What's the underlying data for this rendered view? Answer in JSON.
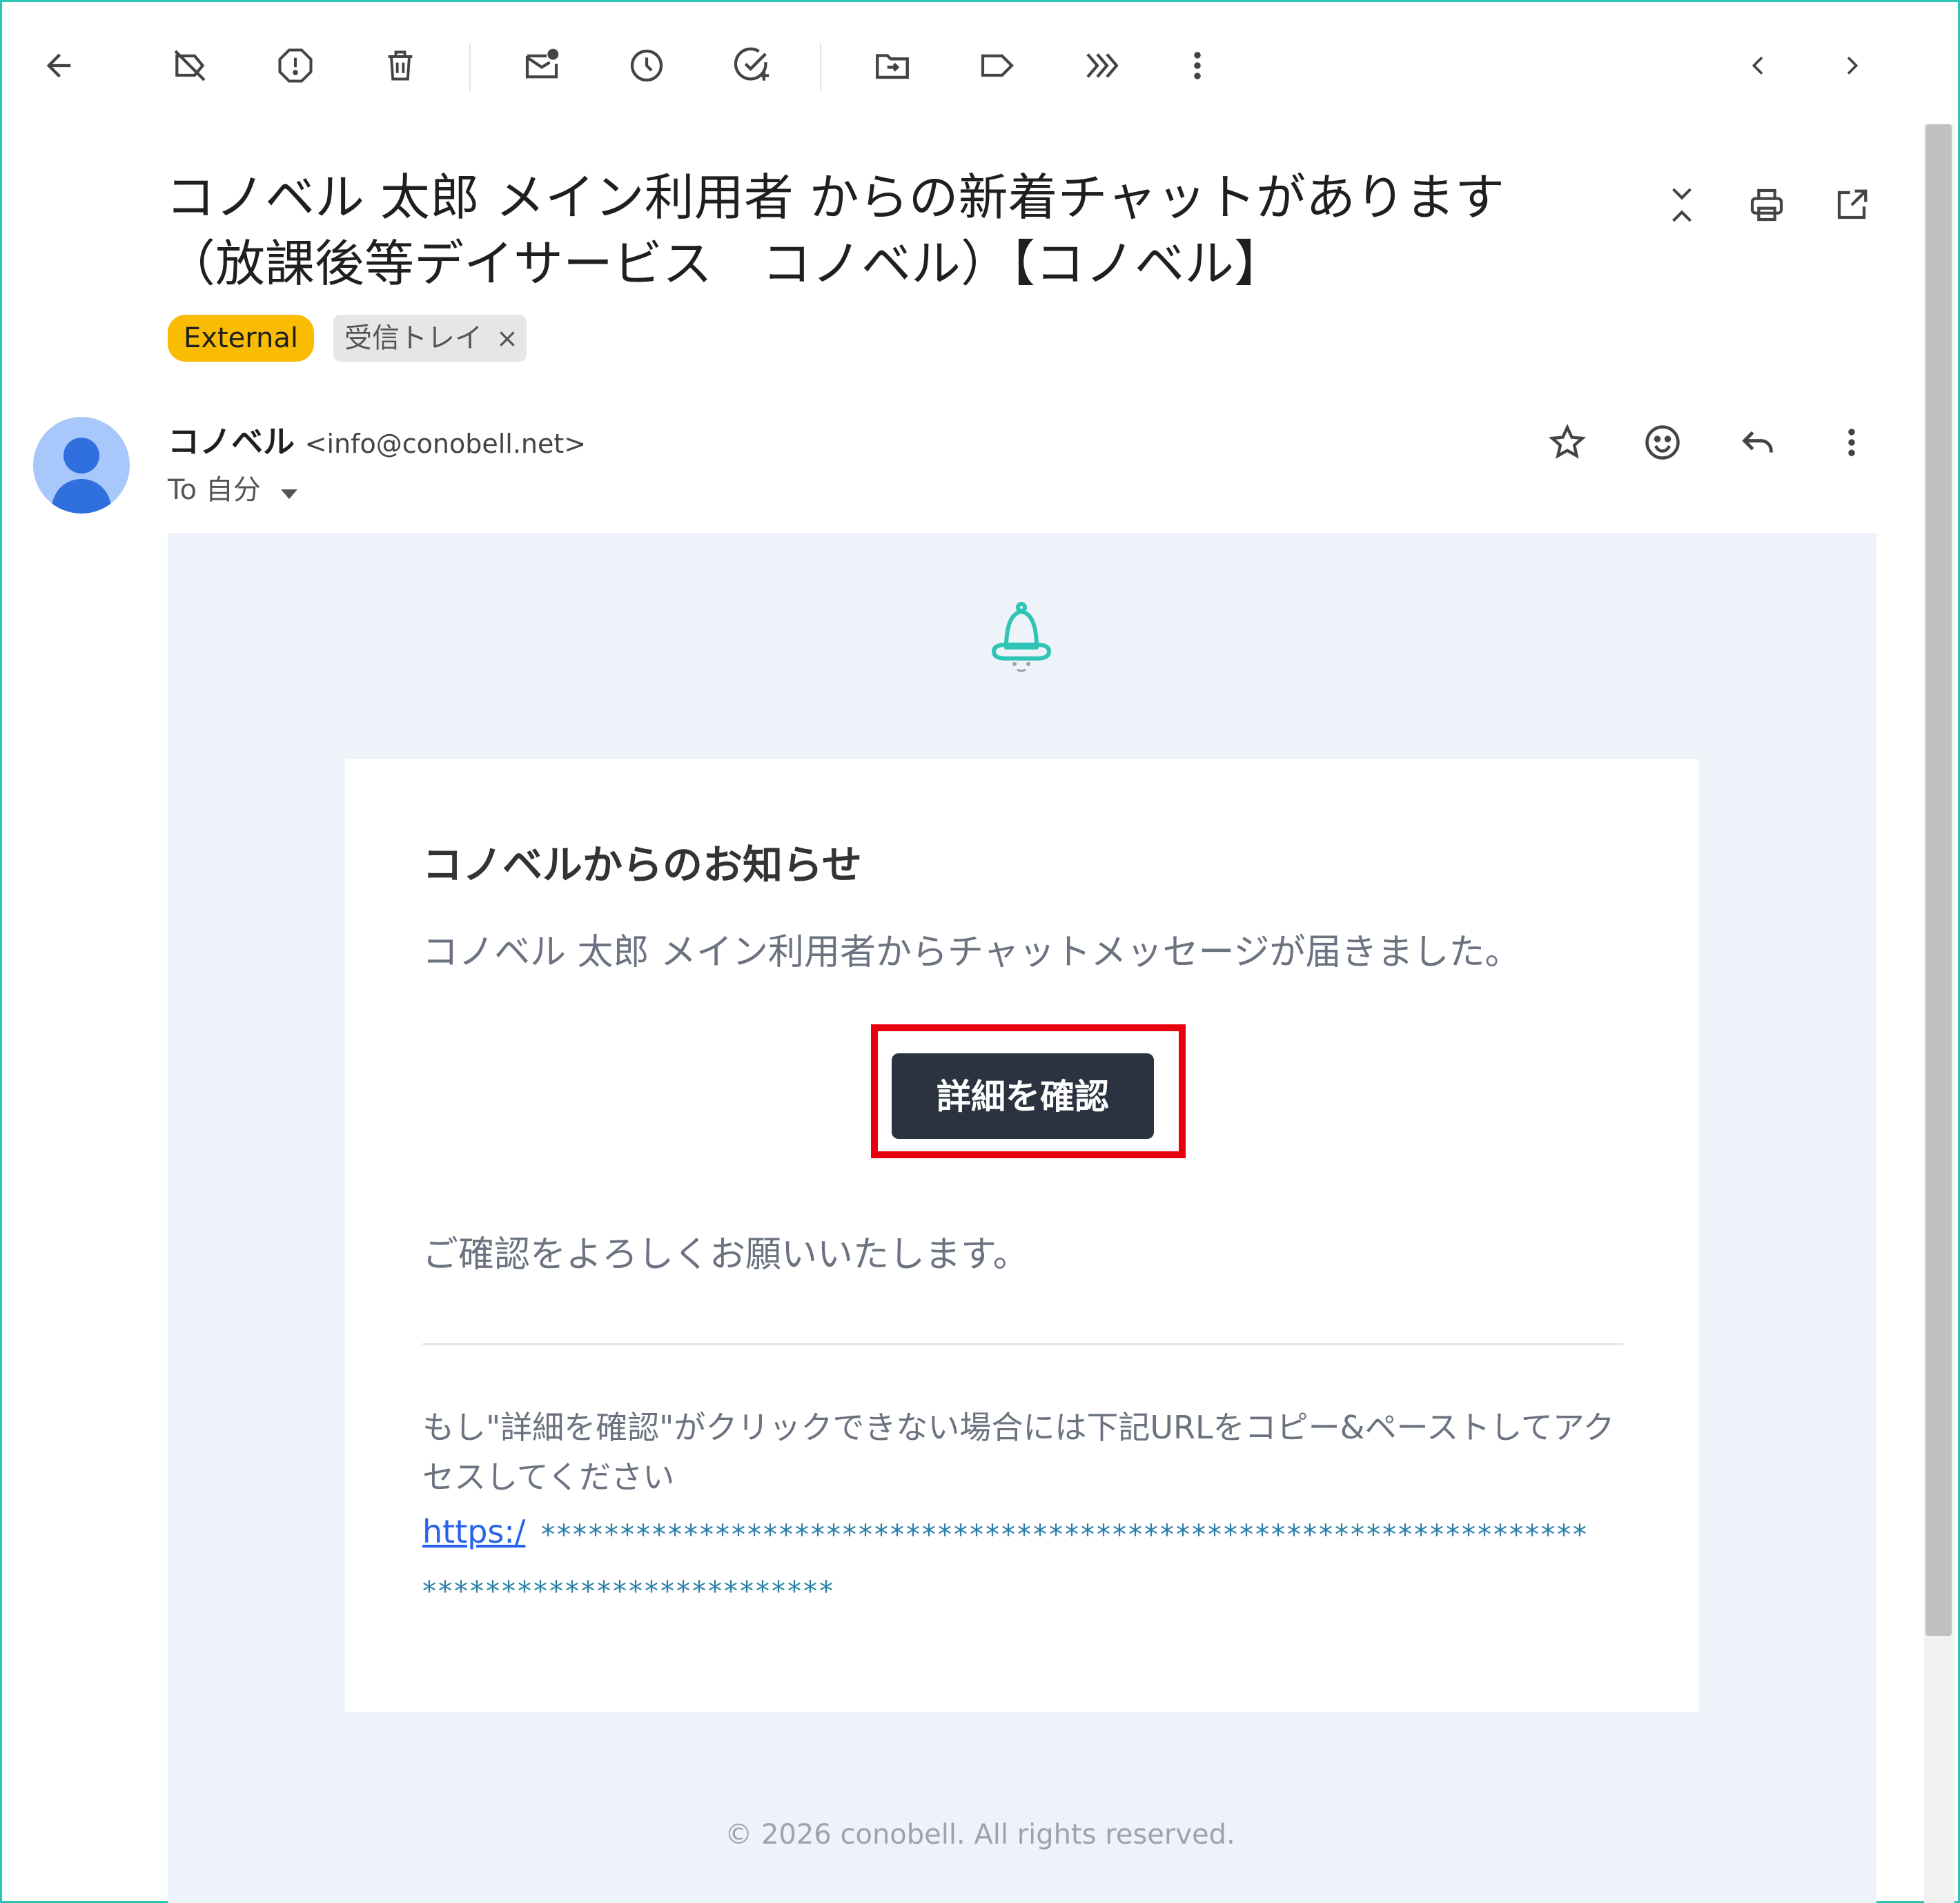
{
  "toolbar": {
    "icons": [
      "back-arrow-icon",
      "label-off-icon",
      "report-spam-icon",
      "delete-icon",
      "mark-unread-icon",
      "snooze-icon",
      "add-task-icon",
      "move-to-icon",
      "label-icon",
      "forward-multiple-icon",
      "more-vert-icon",
      "newer-icon",
      "older-icon"
    ]
  },
  "email": {
    "subject_line1": "コノベル 太郎 メイン利用者 からの新着チャットがあります",
    "subject_line2": "（放課後等デイサービス　コノベル）【コノベル】",
    "chips": {
      "external": "External",
      "inbox": "受信トレイ",
      "inbox_remove": "×"
    },
    "sender_name": "コノベル",
    "sender_email": "<info@conobell.net>",
    "to_line": "To 自分"
  },
  "content": {
    "heading": "コノベルからのお知らせ",
    "body": "コノベル 太郎 メイン利用者からチャットメッセージが届きました。",
    "button": "詳細を確認",
    "closing": "ご確認をよろしくお願いいたします。",
    "note": "もし\"詳細を確認\"がクリックできない場合には下記URLをコピー&ペーストしてアクセスしてください",
    "link": "https:/",
    "masked1": "******************************************************************",
    "masked2": "**************************",
    "footer": "© 2026 conobell. All rights reserved."
  },
  "colors": {
    "accent_teal": "#2ec4b6",
    "external_chip": "#f9bc02",
    "button_bg": "#2c3340",
    "highlight_box": "#e8000f",
    "mail_background": "#eef2f9"
  }
}
